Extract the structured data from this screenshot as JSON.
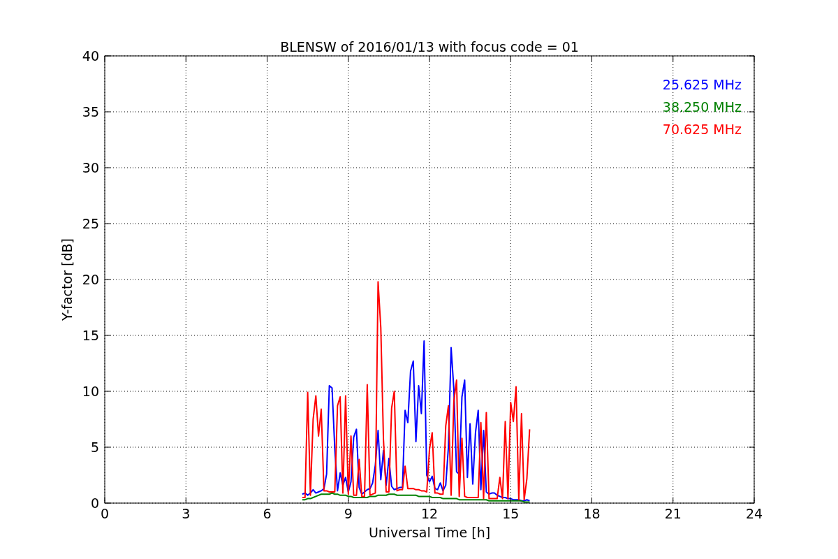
{
  "chart_data": {
    "type": "line",
    "title": "BLENSW of 2016/01/13 with focus code = 01",
    "xlabel": "Universal Time [h]",
    "ylabel": "Y-factor [dB]",
    "xlim": [
      0,
      24
    ],
    "ylim": [
      0,
      40
    ],
    "xticks": [
      0,
      3,
      6,
      9,
      12,
      15,
      18,
      21,
      24
    ],
    "yticks": [
      0,
      5,
      10,
      15,
      20,
      25,
      30,
      35,
      40
    ],
    "grid": true,
    "x": [
      7.3,
      7.4,
      7.5,
      7.6,
      7.7,
      7.8,
      7.9,
      8.0,
      8.1,
      8.2,
      8.3,
      8.4,
      8.5,
      8.6,
      8.7,
      8.8,
      8.9,
      9.0,
      9.1,
      9.2,
      9.3,
      9.4,
      9.5,
      9.6,
      9.7,
      9.8,
      9.9,
      10.0,
      10.1,
      10.2,
      10.3,
      10.4,
      10.5,
      10.6,
      10.7,
      10.8,
      10.9,
      11.0,
      11.1,
      11.2,
      11.3,
      11.4,
      11.5,
      11.6,
      11.7,
      11.8,
      11.9,
      12.0,
      12.1,
      12.2,
      12.3,
      12.4,
      12.5,
      12.6,
      12.7,
      12.8,
      12.9,
      13.0,
      13.1,
      13.2,
      13.3,
      13.4,
      13.5,
      13.6,
      13.7,
      13.8,
      13.9,
      14.0,
      14.1,
      14.2,
      14.3,
      14.4,
      14.5,
      14.6,
      14.7,
      14.8,
      14.9,
      15.0,
      15.1,
      15.2,
      15.3,
      15.4,
      15.5,
      15.6,
      15.7
    ],
    "series": [
      {
        "name": "25.625 MHz",
        "color": "#0000ff",
        "values": [
          0.8,
          0.9,
          0.7,
          0.9,
          1.2,
          0.9,
          1.0,
          1.1,
          1.3,
          2.6,
          10.5,
          10.3,
          4.9,
          1.1,
          2.7,
          1.6,
          2.3,
          1.0,
          1.9,
          5.9,
          6.6,
          1.4,
          0.8,
          1.0,
          1.2,
          1.3,
          1.8,
          3.4,
          6.5,
          2.1,
          4.7,
          1.6,
          4.0,
          1.5,
          1.2,
          1.3,
          1.4,
          1.4,
          8.3,
          7.2,
          11.8,
          12.7,
          5.5,
          10.5,
          8.0,
          14.5,
          2.5,
          1.9,
          2.4,
          1.3,
          1.2,
          1.8,
          1.1,
          1.6,
          5.0,
          13.9,
          10.2,
          2.8,
          2.6,
          9.5,
          11.0,
          2.3,
          7.1,
          1.7,
          6.3,
          8.3,
          1.2,
          6.5,
          1.0,
          0.8,
          0.9,
          0.9,
          0.7,
          0.6,
          0.5,
          0.5,
          0.4,
          0.4,
          0.3,
          0.3,
          0.3,
          0.2,
          0.2,
          0.3,
          0.2
        ]
      },
      {
        "name": "38.250 MHz",
        "color": "#008000",
        "values": [
          0.3,
          0.3,
          0.4,
          0.4,
          0.5,
          0.6,
          0.7,
          0.8,
          0.8,
          0.8,
          0.8,
          0.9,
          0.8,
          0.8,
          0.7,
          0.7,
          0.7,
          0.6,
          0.6,
          0.5,
          0.5,
          0.5,
          0.5,
          0.5,
          0.5,
          0.6,
          0.6,
          0.6,
          0.7,
          0.7,
          0.7,
          0.7,
          0.8,
          0.8,
          0.8,
          0.7,
          0.7,
          0.7,
          0.7,
          0.7,
          0.7,
          0.7,
          0.7,
          0.6,
          0.6,
          0.6,
          0.6,
          0.6,
          0.5,
          0.5,
          0.5,
          0.5,
          0.4,
          0.4,
          0.4,
          0.4,
          0.4,
          0.4,
          0.3,
          0.3,
          0.3,
          0.3,
          0.3,
          0.3,
          0.3,
          0.3,
          0.3,
          0.3,
          0.3,
          0.2,
          0.2,
          0.2,
          0.2,
          0.2,
          0.2,
          0.2,
          0.2,
          0.2,
          0.2,
          0.2,
          0.2,
          0.2,
          0.1,
          0.1,
          0.1
        ]
      },
      {
        "name": "70.625 MHz",
        "color": "#ff0000",
        "values": [
          0.5,
          0.5,
          9.9,
          0.7,
          7.5,
          9.6,
          6.0,
          8.4,
          1.1,
          1.1,
          1.0,
          1.0,
          1.0,
          8.7,
          9.5,
          0.9,
          9.6,
          0.8,
          6.0,
          0.7,
          0.7,
          3.9,
          0.6,
          0.6,
          10.6,
          0.7,
          0.8,
          0.9,
          19.8,
          15.7,
          5.7,
          1.0,
          1.0,
          8.5,
          10.0,
          1.1,
          1.2,
          1.2,
          3.3,
          1.3,
          1.3,
          1.3,
          1.2,
          1.2,
          1.1,
          1.1,
          1.0,
          4.8,
          6.3,
          0.9,
          0.9,
          0.8,
          0.8,
          6.9,
          8.7,
          0.7,
          9.1,
          11.0,
          0.6,
          5.8,
          0.6,
          0.5,
          0.5,
          0.5,
          0.5,
          0.5,
          7.2,
          0.4,
          8.1,
          0.4,
          0.4,
          0.4,
          0.4,
          2.3,
          0.4,
          7.3,
          0.4,
          9.0,
          7.3,
          10.4,
          0.3,
          8.0,
          0.3,
          2.2,
          6.6
        ]
      }
    ]
  }
}
